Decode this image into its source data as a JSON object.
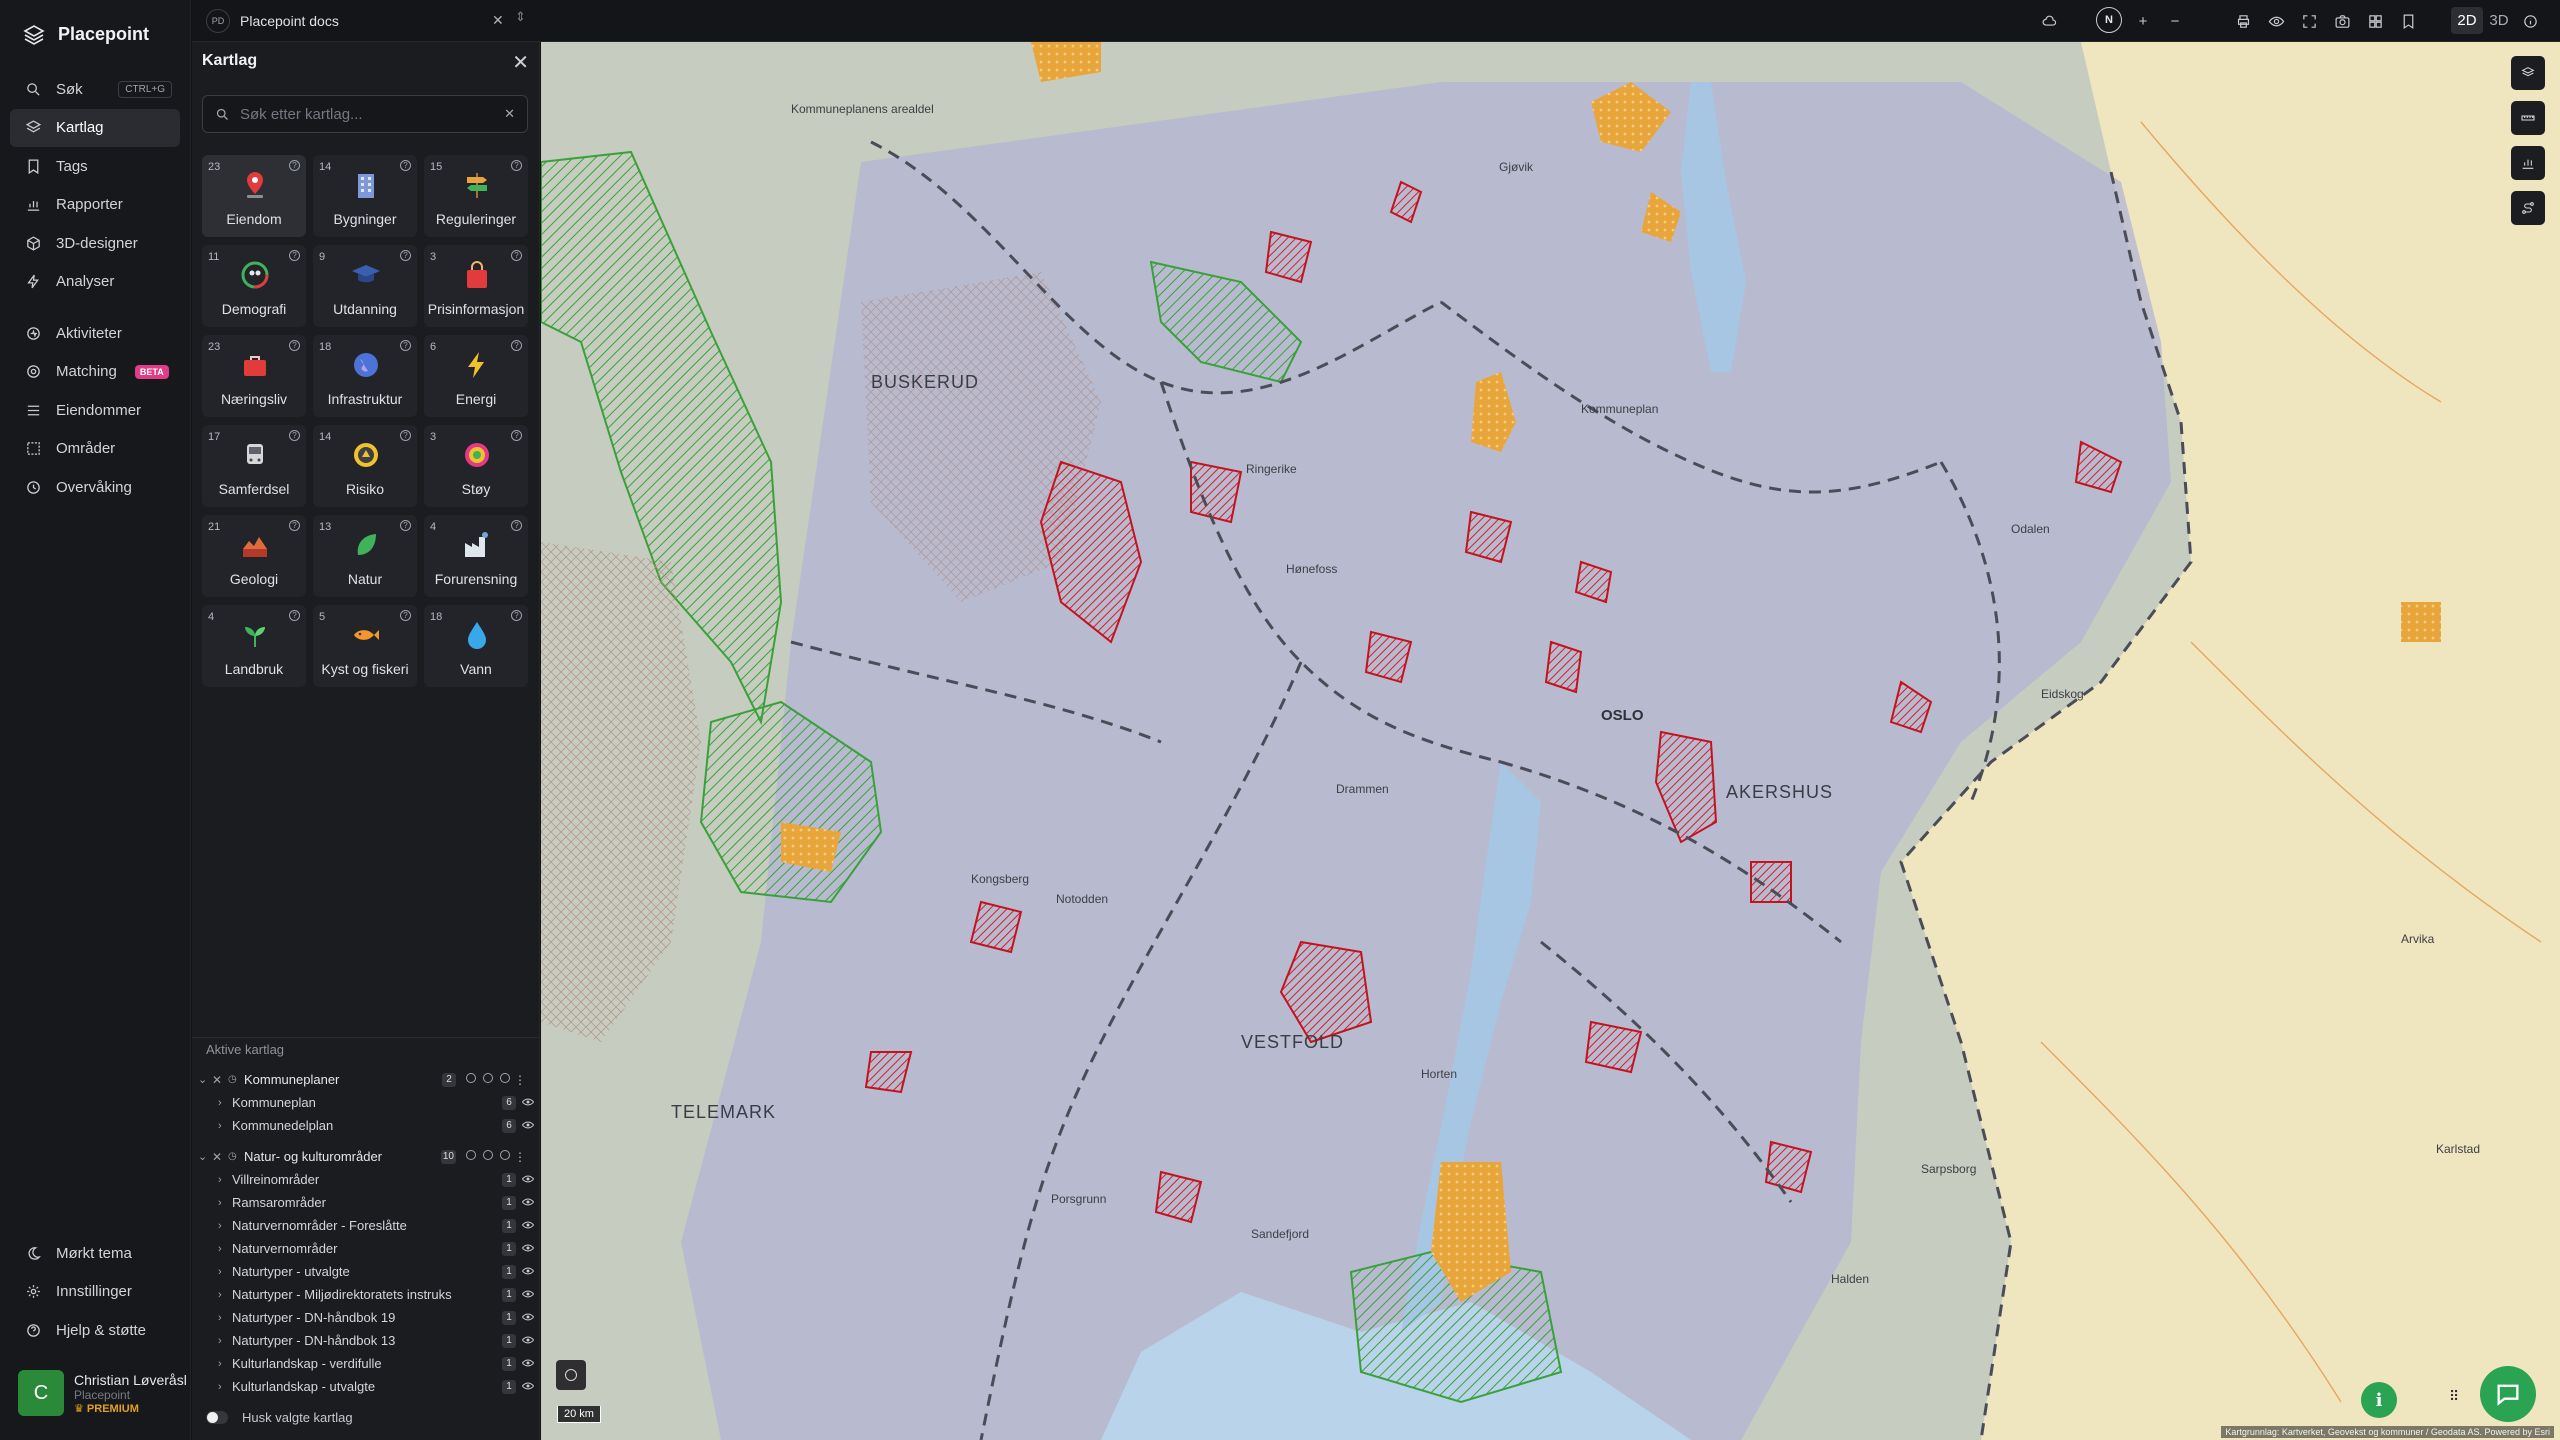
{
  "app": {
    "name": "Placepoint"
  },
  "nav": {
    "items": [
      {
        "label": "Søk",
        "shortcut": "CTRL+G",
        "icon": "search-icon"
      },
      {
        "label": "Kartlag",
        "icon": "layers-icon",
        "active": true
      },
      {
        "label": "Tags",
        "icon": "bookmark-icon"
      },
      {
        "label": "Rapporter",
        "icon": "chart-icon"
      },
      {
        "label": "3D-designer",
        "icon": "cube-icon"
      },
      {
        "label": "Analyser",
        "icon": "bolt-icon"
      }
    ],
    "items2": [
      {
        "label": "Aktiviteter",
        "icon": "activity-icon"
      },
      {
        "label": "Matching",
        "icon": "target-icon",
        "badge": "BETA"
      },
      {
        "label": "Eiendommer",
        "icon": "list-icon"
      },
      {
        "label": "Områder",
        "icon": "area-icon"
      },
      {
        "label": "Overvåking",
        "icon": "clock-icon"
      }
    ],
    "bottom": [
      {
        "label": "Mørkt tema",
        "icon": "moon-icon"
      },
      {
        "label": "Innstillinger",
        "icon": "gear-icon"
      },
      {
        "label": "Hjelp & støtte",
        "icon": "help-icon"
      }
    ]
  },
  "user": {
    "initial": "C",
    "name": "Christian Løveråsl",
    "org": "Placepoint",
    "plan": "PREMIUM"
  },
  "topbar": {
    "doc_badge": "PD",
    "doc_title": "Placepoint docs",
    "mode_2d": "2D",
    "mode_3d": "3D",
    "compass": "N"
  },
  "panel": {
    "title": "Kartlag",
    "search_placeholder": "Søk etter kartlag...",
    "categories": [
      {
        "label": "Eiendom",
        "count": "23",
        "icon": "pin-icon",
        "active": true
      },
      {
        "label": "Bygninger",
        "count": "14",
        "icon": "building-icon"
      },
      {
        "label": "Reguleringer",
        "count": "15",
        "icon": "signpost-icon"
      },
      {
        "label": "Demografi",
        "count": "11",
        "icon": "people-icon"
      },
      {
        "label": "Utdanning",
        "count": "9",
        "icon": "graduation-icon"
      },
      {
        "label": "Prisinformasjon",
        "count": "3",
        "icon": "shopping-bag-icon"
      },
      {
        "label": "Næringsliv",
        "count": "23",
        "icon": "briefcase-icon"
      },
      {
        "label": "Infrastruktur",
        "count": "18",
        "icon": "globe-icon"
      },
      {
        "label": "Energi",
        "count": "6",
        "icon": "lightning-icon"
      },
      {
        "label": "Samferdsel",
        "count": "17",
        "icon": "bus-icon"
      },
      {
        "label": "Risiko",
        "count": "14",
        "icon": "hazard-icon"
      },
      {
        "label": "Støy",
        "count": "3",
        "icon": "noise-icon"
      },
      {
        "label": "Geologi",
        "count": "21",
        "icon": "terrain-icon"
      },
      {
        "label": "Natur",
        "count": "13",
        "icon": "leaf-icon"
      },
      {
        "label": "Forurensning",
        "count": "4",
        "icon": "factory-icon"
      },
      {
        "label": "Landbruk",
        "count": "4",
        "icon": "sprout-icon"
      },
      {
        "label": "Kyst og fiskeri",
        "count": "5",
        "icon": "fish-icon"
      },
      {
        "label": "Vann",
        "count": "18",
        "icon": "water-drop-icon"
      }
    ],
    "active_header": "Aktive kartlag",
    "groups": [
      {
        "name": "Kommuneplaner",
        "count": "2",
        "children": [
          {
            "name": "Kommuneplan",
            "count": "6"
          },
          {
            "name": "Kommunedelplan",
            "count": "6"
          }
        ]
      },
      {
        "name": "Natur- og kulturområder",
        "count": "10",
        "children": [
          {
            "name": "Villreinområder",
            "count": "1"
          },
          {
            "name": "Ramsarområder",
            "count": "1"
          },
          {
            "name": "Naturvernområder - Foreslåtte",
            "count": "1"
          },
          {
            "name": "Naturvernområder",
            "count": "1"
          },
          {
            "name": "Naturtyper - utvalgte",
            "count": "1"
          },
          {
            "name": "Naturtyper - Miljødirektoratets instruks",
            "count": "1"
          },
          {
            "name": "Naturtyper - DN-håndbok 19",
            "count": "1"
          },
          {
            "name": "Naturtyper - DN-håndbok 13",
            "count": "1"
          },
          {
            "name": "Kulturlandskap - verdifulle",
            "count": "1"
          },
          {
            "name": "Kulturlandskap - utvalgte",
            "count": "1"
          }
        ]
      }
    ],
    "remember_label": "Husk valgte kartlag"
  },
  "map": {
    "labels": [
      {
        "text": "BUSKERUD",
        "cls": "big"
      },
      {
        "text": "OSLO",
        "cls": "city"
      },
      {
        "text": "AKERSHUS",
        "cls": "big"
      },
      {
        "text": "VESTFOLD",
        "cls": "big"
      },
      {
        "text": "TELEMARK",
        "cls": "big"
      },
      {
        "text": "Ringerike",
        "cls": ""
      },
      {
        "text": "Hønefoss",
        "cls": ""
      },
      {
        "text": "Drammen",
        "cls": ""
      },
      {
        "text": "Kongsberg",
        "cls": ""
      },
      {
        "text": "Horten",
        "cls": ""
      },
      {
        "text": "Sarpsborg",
        "cls": ""
      },
      {
        "text": "Halden",
        "cls": ""
      },
      {
        "text": "Gjøvik",
        "cls": ""
      },
      {
        "text": "Notodden",
        "cls": ""
      },
      {
        "text": "Porsgrunn",
        "cls": ""
      },
      {
        "text": "Sandefjord",
        "cls": ""
      },
      {
        "text": "Kommuneplanens arealdel",
        "cls": ""
      },
      {
        "text": "Kommuneplan",
        "cls": ""
      },
      {
        "text": "Odalen",
        "cls": ""
      },
      {
        "text": "Eidskog",
        "cls": ""
      },
      {
        "text": "Karlstad",
        "cls": ""
      },
      {
        "text": "Arvika",
        "cls": ""
      }
    ],
    "scale": "20 km",
    "attribution": "Kartgrunnlag: Kartverket, Geovekst og kommuner / Geodata AS. Powered by Esri"
  }
}
